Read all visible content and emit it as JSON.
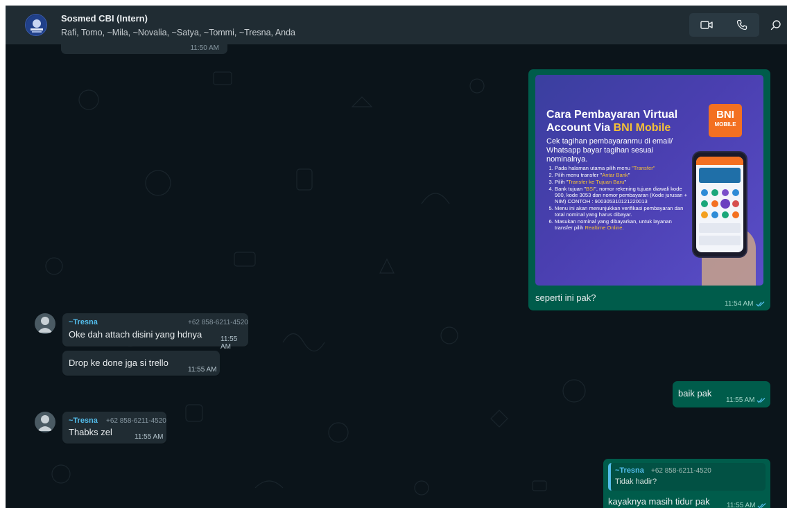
{
  "header": {
    "group_name": "Sosmed CBI (Intern)",
    "members": "Rafi, Tomo, ~Mila, ~Novalia, ~Satya, ~Tommi, ~Tresna, Anda",
    "icons": [
      "video-call-icon",
      "voice-call-icon",
      "search-icon"
    ]
  },
  "messages": {
    "cut_time": "11:50 AM",
    "image_msg": {
      "caption": "seperti ini pak?",
      "time": "11:54 AM",
      "image": {
        "title_line1": "Cara Pembayaran Virtual",
        "title_line2_a": "Account Via ",
        "title_line2_b": "BNI Mobile",
        "subtitle": "Cek tagihan pembayaranmu di email/ Whatsapp bayar tagihan sesuai nominalnya.",
        "logo_top": "BNI",
        "logo_bottom": "MOBILE",
        "steps": [
          {
            "a": "Pada halaman utama pilih menu ",
            "h": "\"Transfer\"",
            "b": ""
          },
          {
            "a": "Pilih menu transfer \"",
            "h": "Antar Bank",
            "b": "\""
          },
          {
            "a": "Pilih \"",
            "h": "Transfer ke Tujuan Baru",
            "b": "\""
          },
          {
            "a": "Bank tujuan \"",
            "h": "BSI",
            "b": "\", nomor rekening tujuan diawali kode 900, kode 3053 dan nomor pembayaran (Kode jurusan + NIM) CONTOH : 900305310121220013"
          },
          {
            "a": "Menu ini akan menunjukkan verifikasi pembayaran dan total nominal yang harus dibayar.",
            "h": "",
            "b": ""
          },
          {
            "a": "Masukan nominal yang dibayarkan, untuk layanan transfer pilih ",
            "h": "Realtime Online",
            "b": "."
          }
        ]
      }
    },
    "tresna1": {
      "sender": "~Tresna",
      "phone": "+62 858-6211-4520",
      "text": "Oke dah attach disini yang hdnya",
      "time": "11:55 AM"
    },
    "tresna2": {
      "text": "Drop ke done jga si trello",
      "time": "11:55 AM"
    },
    "out_baik": {
      "text": "baik pak",
      "time": "11:55 AM"
    },
    "tresna3": {
      "sender": "~Tresna",
      "phone": "+62 858-6211-4520",
      "text": "Thabks zel",
      "time": "11:55 AM"
    },
    "out_reply": {
      "quoted_sender": "~Tresna",
      "quoted_phone": "+62 858-6211-4520",
      "quoted_text": "Tidak hadir?",
      "text": "kayaknya masih tidur pak",
      "time": "11:55 AM"
    }
  },
  "colors": {
    "header_bg": "#202c33",
    "chat_bg": "#0b141a",
    "incoming_bubble": "#202c33",
    "outgoing_bubble": "#005c4b",
    "sender_name": "#53bdeb",
    "read_ticks": "#53bdeb",
    "bni_orange": "#f37021",
    "highlight_yellow": "#f6c236"
  }
}
